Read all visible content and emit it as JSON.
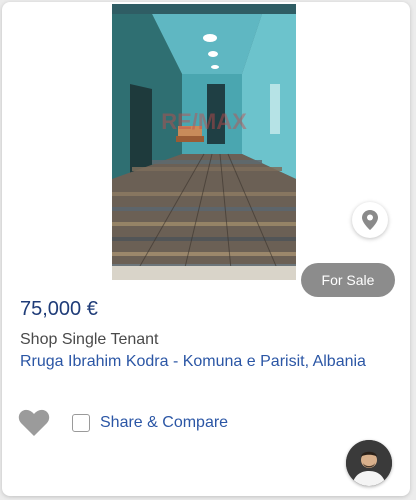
{
  "listing": {
    "status_badge": "For Sale",
    "price": "75,000 €",
    "property_type": "Shop Single Tenant",
    "address": "Rruga Ibrahim Kodra - Komuna e Parisit, Albania",
    "compare_label": "Share & Compare",
    "watermark_text": "RE/MAX"
  },
  "icons": {
    "map_pin": "map-pin-icon",
    "favorite": "heart-icon",
    "compare_checkbox": "checkbox-icon"
  },
  "colors": {
    "price_text": "#1f3c78",
    "link_text": "#2b56a5",
    "badge_bg": "#8c8c8c",
    "heart": "#9b9b9b"
  }
}
